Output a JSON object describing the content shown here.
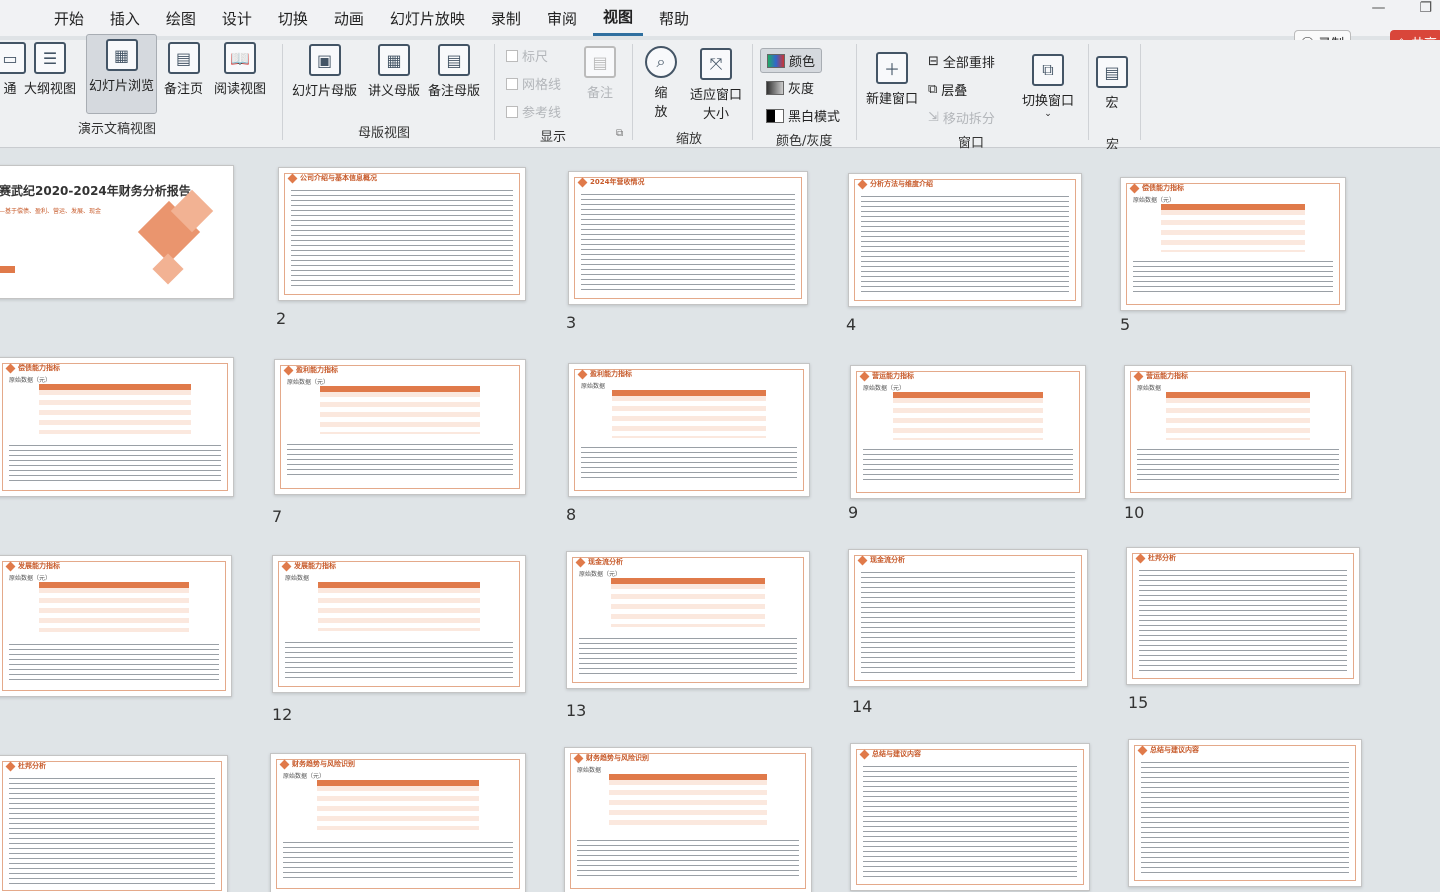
{
  "menubar": {
    "items": [
      "开始",
      "插入",
      "绘图",
      "设计",
      "切换",
      "动画",
      "幻灯片放映",
      "录制",
      "审阅",
      "视图",
      "帮助"
    ],
    "active": "视图",
    "record_label": "录制",
    "share_label": "共享"
  },
  "ribbon": {
    "buttons": {
      "normal": "通",
      "outline": "大纲视图",
      "sorter": "幻灯片浏览",
      "notes": "备注页",
      "reading": "阅读视图",
      "slide_master": "幻灯片母版",
      "handout_master": "讲义母版",
      "notes_master": "备注母版",
      "ruler": "标尺",
      "gridlines": "网格线",
      "guides": "参考线",
      "notes_toggle": "备注",
      "zoom": "缩放",
      "fit": "适应窗口大小",
      "color": "颜色",
      "grayscale": "灰度",
      "bw": "黑白模式",
      "new_window": "新建窗口",
      "arrange_all": "全部重排",
      "cascade": "层叠",
      "move_split": "移动拆分",
      "switch_window": "切换窗口",
      "macros": "宏"
    },
    "groups": {
      "presentation_views": "演示文稿视图",
      "master_views": "母版视图",
      "show": "显示",
      "zoom": "缩放",
      "color": "颜色/灰度",
      "window": "窗口",
      "macros": "宏"
    }
  },
  "slides": [
    {
      "num": "",
      "title": "赛武纪2020-2024年财务分析报告",
      "subtitle": "—基于偿债、盈利、营运、发展、现金",
      "cover": true
    },
    {
      "num": "2",
      "title": "公司介绍与基本信息概况"
    },
    {
      "num": "3",
      "title": "2024年营收情况"
    },
    {
      "num": "4",
      "title": "分析方法与维度介绍"
    },
    {
      "num": "5",
      "title": "偿债能力指标",
      "sub": "原始数据（元）"
    },
    {
      "num": "",
      "title": "偿债能力指标",
      "sub": "原始数据（元）"
    },
    {
      "num": "7",
      "title": "盈利能力指标",
      "sub": "原始数据（元）"
    },
    {
      "num": "8",
      "title": "盈利能力指标",
      "sub": "原始数据"
    },
    {
      "num": "9",
      "title": "营运能力指标",
      "sub": "原始数据（元）"
    },
    {
      "num": "10",
      "title": "营运能力指标",
      "sub": "原始数据"
    },
    {
      "num": "",
      "title": "发展能力指标",
      "sub": "原始数据（元）"
    },
    {
      "num": "12",
      "title": "发展能力指标",
      "sub": "原始数据"
    },
    {
      "num": "13",
      "title": "现金流分析",
      "sub": "原始数据（元）"
    },
    {
      "num": "14",
      "title": "现金流分析"
    },
    {
      "num": "15",
      "title": "杜邦分析"
    },
    {
      "num": "",
      "title": "杜邦分析"
    },
    {
      "num": "",
      "title": "财务趋势与风险识别",
      "sub": "原始数据（元）"
    },
    {
      "num": "",
      "title": "财务趋势与风险识别",
      "sub": "原始数据"
    },
    {
      "num": "",
      "title": "总结与建议内容"
    },
    {
      "num": "",
      "title": "总结与建议内容"
    }
  ]
}
